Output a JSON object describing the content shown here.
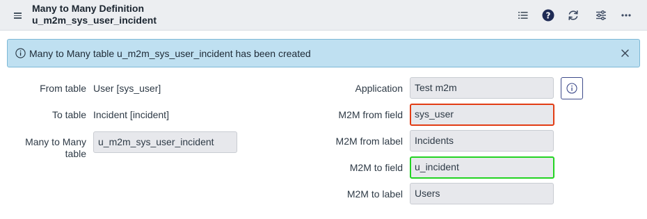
{
  "header": {
    "title": "Many to Many Definition",
    "subtitle": "u_m2m_sys_user_incident",
    "icons": [
      "menu-icon",
      "list-icon",
      "help-icon",
      "refresh-icon",
      "settings-sliders-icon",
      "more-options-icon"
    ]
  },
  "alert": {
    "message": "Many to Many table u_m2m_sys_user_incident has been created",
    "color": "#bfe0f1"
  },
  "left": {
    "from_table_label": "From table",
    "from_table_value": "User [sys_user]",
    "to_table_label": "To table",
    "to_table_value": "Incident [incident]",
    "m2m_table_label_line1": "Many to Many",
    "m2m_table_label_line2": "table",
    "m2m_table_value": "u_m2m_sys_user_incident"
  },
  "right": {
    "application_label": "Application",
    "application_value": "Test m2m",
    "from_field_label": "M2M from field",
    "from_field_value": "sys_user",
    "from_label_label": "M2M from label",
    "from_label_value": "Incidents",
    "to_field_label": "M2M to field",
    "to_field_value": "u_incident",
    "to_label_label": "M2M to label",
    "to_label_value": "Users"
  },
  "highlight_colors": {
    "red": "#e23c14",
    "green": "#22d321"
  }
}
